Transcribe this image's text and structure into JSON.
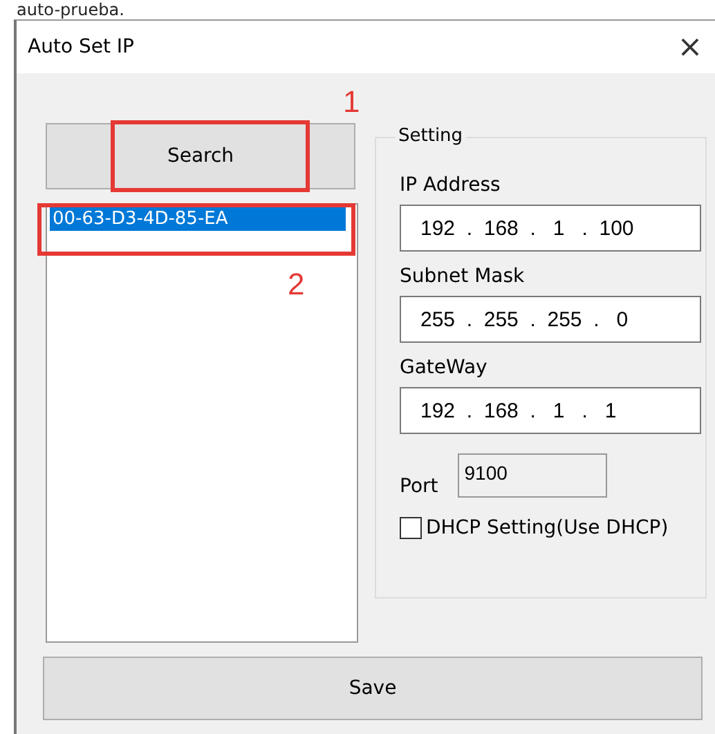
{
  "caption": "auto-prueba.",
  "window": {
    "title": "Auto Set IP",
    "close": "×"
  },
  "search_button": "Search",
  "device_list": [
    {
      "label": "00-63-D3-4D-85-EA",
      "selected": true
    }
  ],
  "setting": {
    "title": "Setting",
    "fields": [
      {
        "kind": "ip",
        "label": "IP Address",
        "value": "192  .  168  .   1   .  100"
      },
      {
        "kind": "ip",
        "label": "Subnet Mask",
        "value": "255  .  255  .  255  .   0"
      },
      {
        "kind": "ip",
        "label": "GateWay",
        "value": "192  .  168  .   1   .   1"
      },
      {
        "kind": "port",
        "label": "Port",
        "value": "9100"
      }
    ],
    "dhcp": {
      "label": "DHCP Setting(Use DHCP)",
      "checked": false
    }
  },
  "save_button": "Save",
  "annotations": [
    {
      "kind": "search",
      "number": "1"
    },
    {
      "kind": "device",
      "number": "2"
    }
  ]
}
